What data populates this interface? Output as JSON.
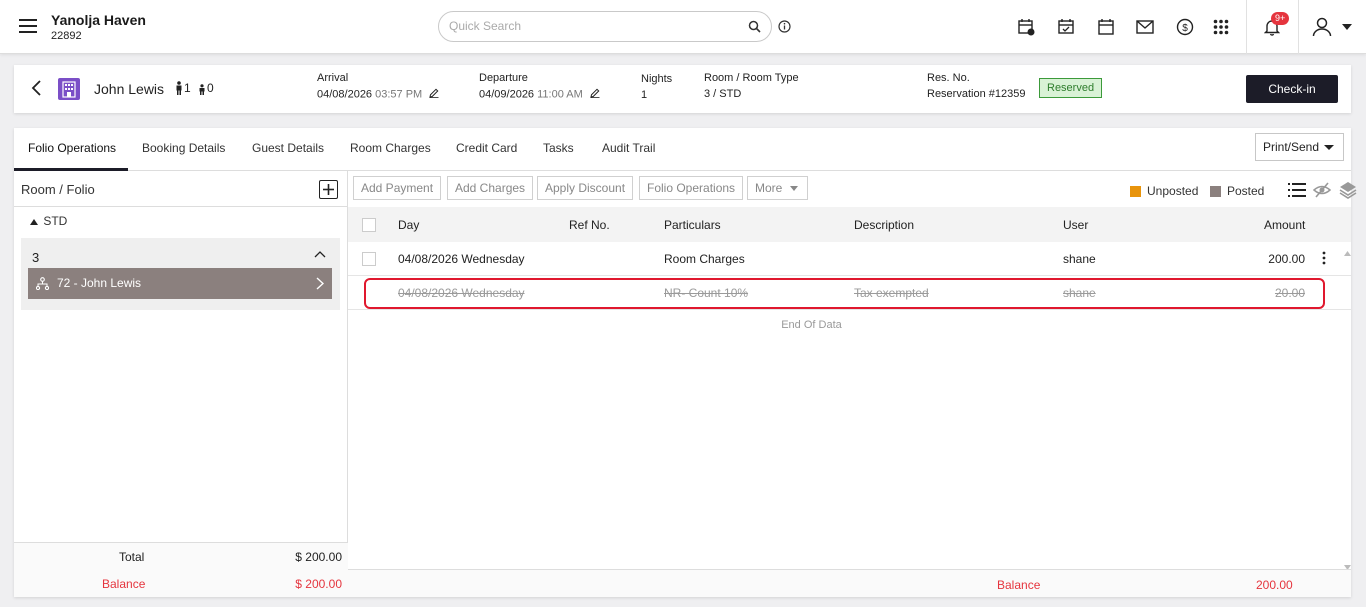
{
  "header": {
    "property_name": "Yanolja Haven",
    "property_code": "22892",
    "search_placeholder": "Quick Search",
    "notification_badge": "9+"
  },
  "reservation": {
    "guest_name": "John Lewis",
    "adults": "1",
    "children": "0",
    "arrival_label": "Arrival",
    "arrival_date": "04/08/2026",
    "arrival_time": "03:57 PM",
    "departure_label": "Departure",
    "departure_date": "04/09/2026",
    "departure_time": "11:00 AM",
    "nights_label": "Nights",
    "nights_value": "1",
    "room_label": "Room / Room Type",
    "room_value": "3 / STD",
    "resno_label": "Res. No.",
    "resno_value": "Reservation #12359",
    "status": "Reserved",
    "status_color": "#3c9a3a",
    "checkin_label": "Check-in"
  },
  "tabs": [
    "Folio Operations",
    "Booking Details",
    "Guest Details",
    "Room Charges",
    "Credit Card",
    "Tasks",
    "Audit Trail"
  ],
  "print_label": "Print/Send",
  "left_pane": {
    "title": "Room / Folio",
    "group": "STD",
    "room_number": "3",
    "folio_item": "72 - John Lewis",
    "total_label": "Total",
    "total_value": "$ 200.00",
    "balance_label": "Balance",
    "balance_value": "$ 200.00"
  },
  "actions": {
    "add_payment": "Add Payment",
    "add_charges": "Add Charges",
    "apply_discount": "Apply Discount",
    "folio_operations": "Folio Operations",
    "more": "More"
  },
  "legend": {
    "unposted": "Unposted",
    "unposted_color": "#e8940c",
    "posted": "Posted",
    "posted_color": "#8b807e"
  },
  "table": {
    "columns": [
      "Day",
      "Ref No.",
      "Particulars",
      "Description",
      "User",
      "Amount"
    ],
    "rows": [
      {
        "day": "04/08/2026 Wednesday",
        "ref": "",
        "particulars": "Room Charges",
        "description": "",
        "user": "shane",
        "amount": "200.00",
        "voided": false
      },
      {
        "day": "04/08/2026 Wednesday",
        "ref": "",
        "particulars": "NR- Count 10%",
        "description": "Tax exempted",
        "user": "shane",
        "amount": "20.00",
        "voided": true
      }
    ],
    "end_text": "End Of Data",
    "balance_label": "Balance",
    "balance_value": "200.00"
  }
}
